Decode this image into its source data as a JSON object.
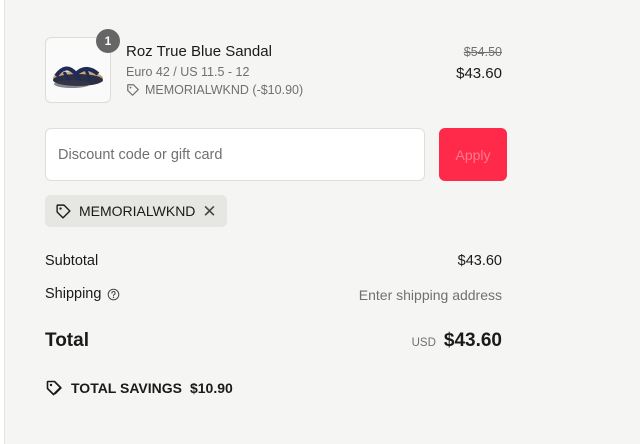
{
  "cart_item": {
    "quantity": "1",
    "name": "Roz True Blue Sandal",
    "variant": "Euro 42 / US 11.5 - 12",
    "discount_line": "MEMORIALWKND (-$10.90)",
    "original_price": "$54.50",
    "price": "$43.60"
  },
  "discount": {
    "placeholder": "Discount code or gift card",
    "apply_label": "Apply",
    "applied_code": "MEMORIALWKND"
  },
  "summary": {
    "subtotal_label": "Subtotal",
    "subtotal_value": "$43.60",
    "shipping_label": "Shipping",
    "shipping_value": "Enter shipping address",
    "total_label": "Total",
    "currency": "USD",
    "total_value": "$43.60",
    "savings_label": "TOTAL SAVINGS",
    "savings_value": "$10.90"
  },
  "icons": {
    "tag": "tag-icon",
    "remove": "close-icon",
    "help": "help-circle-icon",
    "savings": "savings-tag-icon"
  },
  "colors": {
    "apply_button": "#ff2a4a",
    "panel_background": "#f5f5f3"
  }
}
